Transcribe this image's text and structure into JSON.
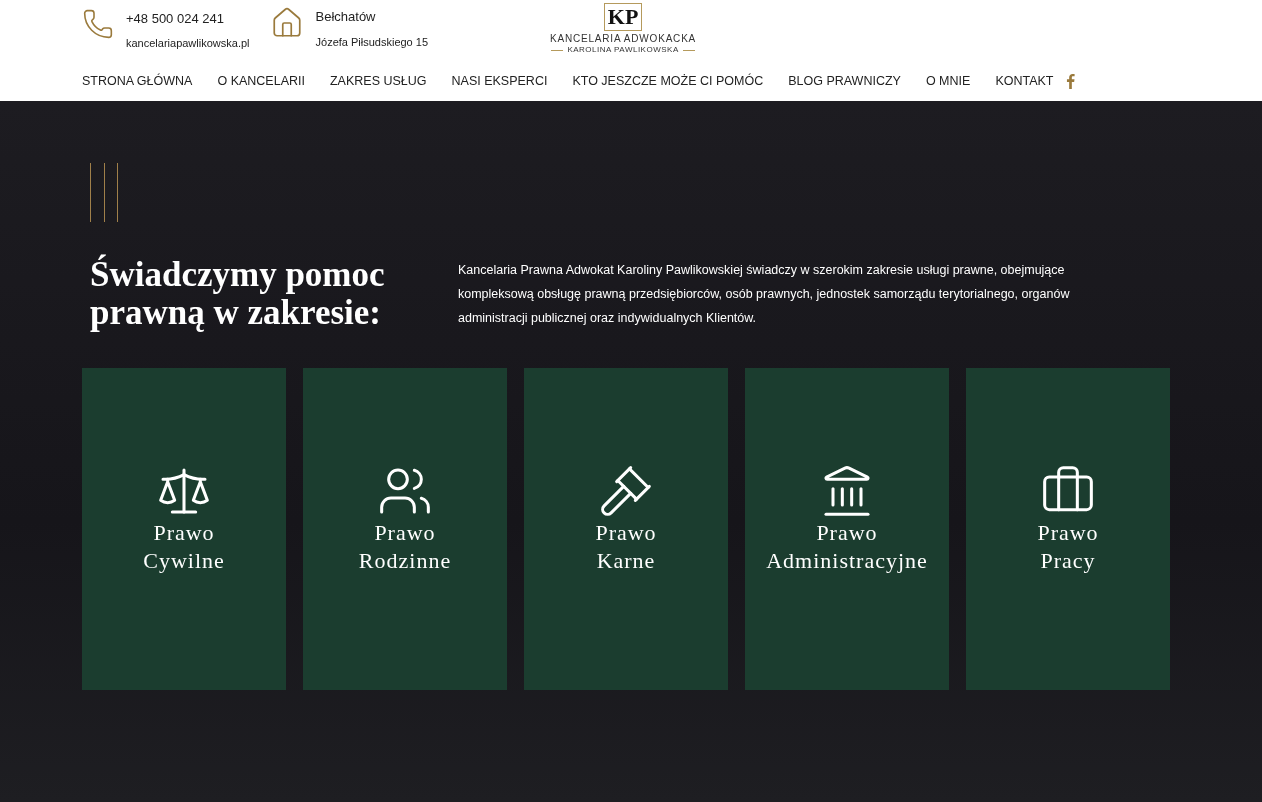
{
  "contact": {
    "phone": "+48 500 024 241",
    "email": "kancelariapawlikowska.pl",
    "city": "Bełchatów",
    "address": "Józefa Piłsudskiego 15"
  },
  "logo": {
    "monogram": "KP",
    "name": "KANCELARIA ADWOKACKA",
    "owner": "KAROLINA PAWLIKOWSKA"
  },
  "nav": [
    "STRONA GŁÓWNA",
    "O KANCELARII",
    "ZAKRES USŁUG",
    "NASI EKSPERCI",
    "KTO JESZCZE MOŻE CI POMÓC",
    "BLOG PRAWNICZY",
    "O MNIE",
    "KONTAKT"
  ],
  "heading": [
    "Świadczymy pomoc",
    "prawną w zakresie:"
  ],
  "intro": "Kancelaria Prawna Adwokat Karoliny Pawlikowskiej świadczy w szerokim zakresie usługi prawne, obejmujące kompleksową obsługę prawną przedsiębiorców, osób prawnych, jednostek samorządu terytorialnego, organów administracji publicznej oraz indywidualnych Klientów.",
  "services": [
    {
      "kind": "scales",
      "title": [
        "Prawo",
        "Cywilne"
      ]
    },
    {
      "kind": "family",
      "title": [
        "Prawo",
        "Rodzinne"
      ]
    },
    {
      "kind": "gavel",
      "title": [
        "Prawo",
        "Karne"
      ]
    },
    {
      "kind": "building",
      "title": [
        "Prawo",
        "Administracyjne"
      ]
    },
    {
      "kind": "briefcase",
      "title": [
        "Prawo",
        "Pracy"
      ]
    }
  ]
}
